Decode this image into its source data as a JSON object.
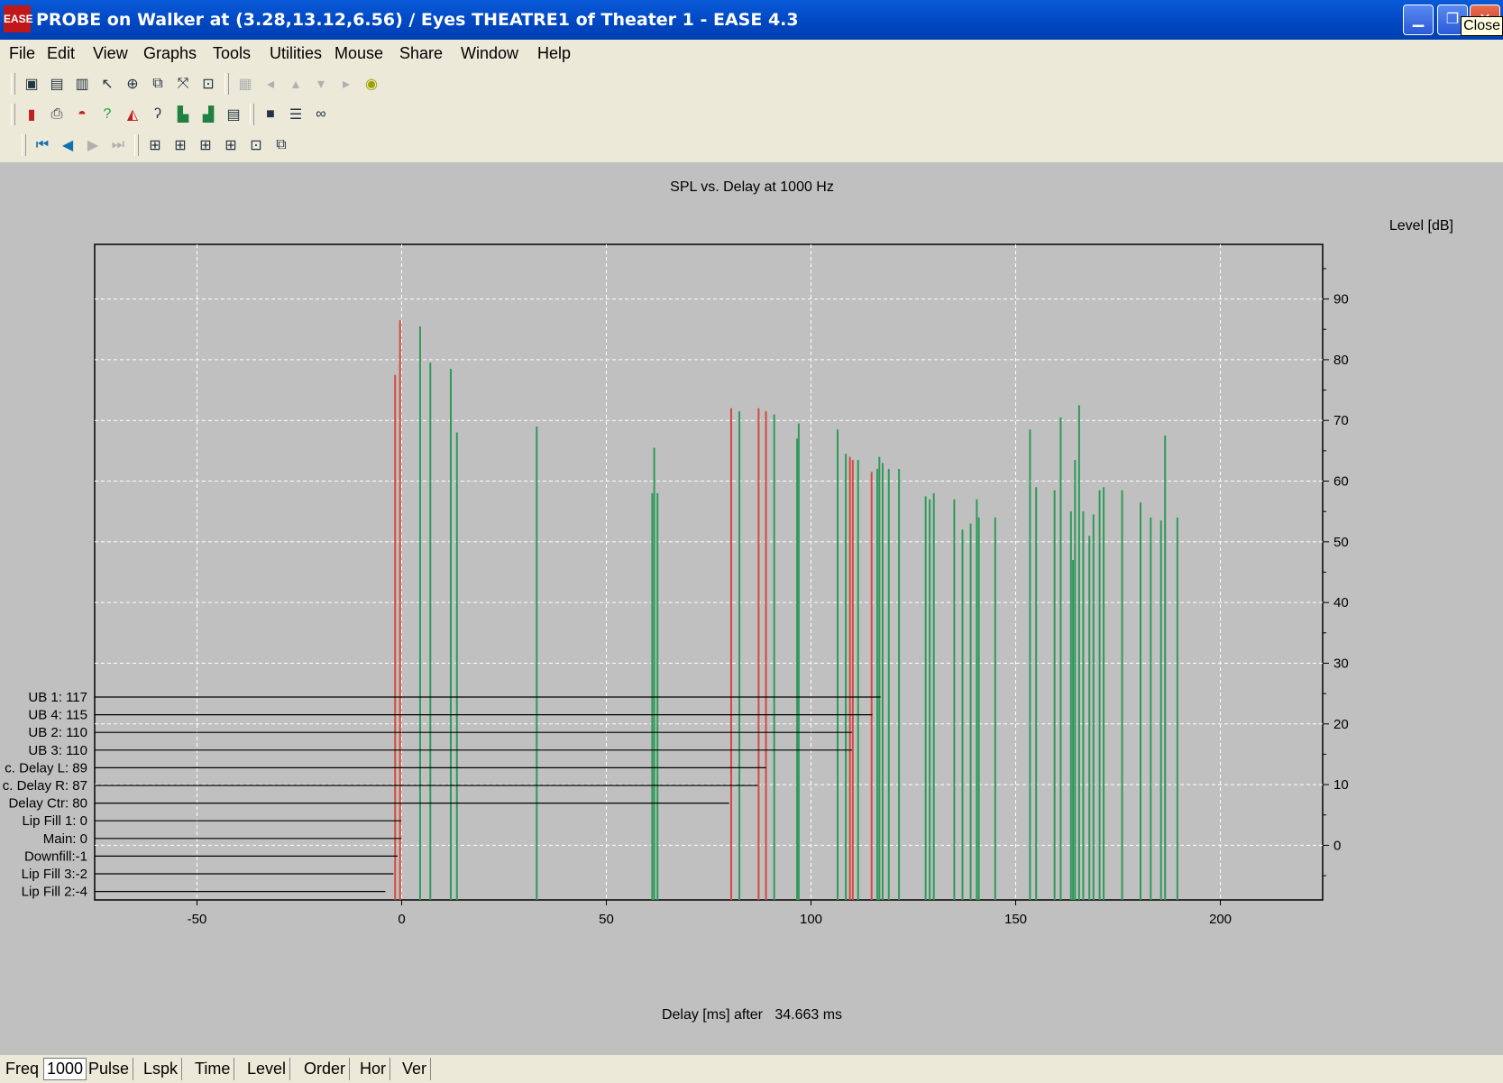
{
  "window": {
    "title": "PROBE on Walker at (3.28,13.12,6.56) / Eyes THEATRE1 of Theater 1 - EASE 4.3",
    "icon_text": "EASE",
    "close_tooltip": "Close"
  },
  "menu": [
    "File",
    "Edit",
    "View",
    "Graphs",
    "Tools",
    "Utilities",
    "Mouse",
    "Share",
    "Window",
    "Help"
  ],
  "toolbar_icons": {
    "row1": [
      "window-a-icon",
      "window-b-icon",
      "window-c-icon",
      "pointer-icon",
      "crosshair-icon",
      "copy-icon",
      "zoom-out-icon",
      "zoom-fit-icon",
      "sep",
      "grid-disabled-icon",
      "left-disabled-icon",
      "up-disabled-icon",
      "down-disabled-icon",
      "right-disabled-icon",
      "target-icon"
    ],
    "row2": [
      "histogram-icon",
      "print-icon",
      "cap-icon",
      "question-icon",
      "area-chart-icon",
      "ear-icon",
      "bar-chart-icon",
      "etc-chart-icon",
      "report-icon",
      "sep",
      "save-icon",
      "settings-icon",
      "infinity-icon"
    ],
    "row3": [
      "first-icon",
      "back-icon",
      "forward-icon",
      "last-icon",
      "sep",
      "tile-1-icon",
      "tile-2-icon",
      "tile-3-icon",
      "tile-4-icon",
      "tile-5-icon",
      "tile-6-icon"
    ]
  },
  "chart_data": {
    "type": "bar",
    "title": "SPL vs. Delay at 1000 Hz",
    "xlabel": "Delay [ms] after   34.663 ms",
    "ylabel": "Level [dB]",
    "xlim": [
      -75,
      225
    ],
    "ylim": [
      -9,
      99
    ],
    "x_ticks": [
      -50,
      0,
      50,
      100,
      150,
      200
    ],
    "y_ticks": [
      0,
      10,
      20,
      30,
      40,
      50,
      60,
      70,
      80,
      90
    ],
    "grid": true,
    "colors": {
      "direct": "#d24a3e",
      "reflection": "#2e9a5a"
    },
    "series": [
      {
        "kind": "direct",
        "x": [
          -1.6,
          -0.4,
          80.5,
          87.2,
          89.0,
          109.5,
          110.2,
          114.8
        ],
        "values": [
          77.5,
          86.5,
          72.0,
          72.0,
          71.5,
          64.0,
          63.5,
          61.5
        ]
      },
      {
        "kind": "reflection",
        "x": [
          4.5,
          7,
          12,
          13.5,
          33,
          61.2,
          61.7,
          62.5,
          82.5,
          91,
          96.6,
          97,
          106.5,
          108.5,
          111.5,
          116.2,
          116.7,
          117.5,
          119,
          121.5,
          128,
          129,
          130,
          135,
          137,
          139,
          140.5,
          141,
          145,
          153.5,
          155,
          159.5,
          161,
          163.5,
          164,
          164.5,
          165.5,
          166.5,
          168,
          169,
          170.5,
          171.5,
          176,
          180.5,
          183,
          185.5,
          186.5,
          189.5
        ],
        "values": [
          85.5,
          79.5,
          78.5,
          68.0,
          69.0,
          58.0,
          65.5,
          58.0,
          71.5,
          71.0,
          67.0,
          69.5,
          68.5,
          64.5,
          63.5,
          62.0,
          64.0,
          63.0,
          62.0,
          62.0,
          57.5,
          57.0,
          58.0,
          57.0,
          52.0,
          53.0,
          57.0,
          54.0,
          54.0,
          68.5,
          59.0,
          58.5,
          70.5,
          55.0,
          47.0,
          63.5,
          72.5,
          55.0,
          51.0,
          54.5,
          58.5,
          59.0,
          58.5,
          56.5,
          54.0,
          53.5,
          67.5,
          54.0
        ]
      }
    ],
    "annotations": [
      {
        "label": "UB 1: 117",
        "x": 117
      },
      {
        "label": "UB 4: 115",
        "x": 115
      },
      {
        "label": "UB 2: 110",
        "x": 110
      },
      {
        "label": "UB 3: 110",
        "x": 110
      },
      {
        "label": "c. Delay L: 89",
        "x": 89
      },
      {
        "label": "c. Delay R: 87",
        "x": 87
      },
      {
        "label": "Delay Ctr: 80",
        "x": 80
      },
      {
        "label": "Lip Fill 1: 0",
        "x": 0
      },
      {
        "label": "Main: 0",
        "x": 0
      },
      {
        "label": "Downfill:-1",
        "x": -1
      },
      {
        "label": "Lip Fill 3:-2",
        "x": -2
      },
      {
        "label": "Lip Fill 2:-4",
        "x": -4
      }
    ]
  },
  "statusbar": {
    "freq_label": "Freq",
    "freq_value": "1000",
    "tabs": [
      "Pulse",
      "Lspk",
      "Time",
      "Level",
      "Order",
      "Hor",
      "Ver"
    ]
  }
}
